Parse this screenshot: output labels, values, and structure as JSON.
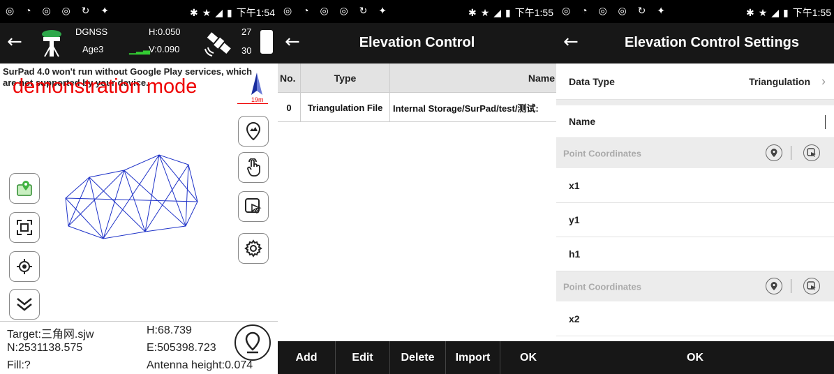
{
  "status_bars": [
    {
      "time": "下午1:54"
    },
    {
      "time": "下午1:55"
    },
    {
      "time": "下午1:55"
    }
  ],
  "survey": {
    "fix_type": "DGNSS",
    "age": "Age3",
    "h_precision": "H:0.050",
    "v_precision": "V:0.090",
    "sats_used": "27",
    "sats_visible": "30",
    "notice": "SurPad 4.0 won't run without Google Play services, which are not supported by your device.",
    "demo_text": "demonstration mode",
    "scale": "19m",
    "target": "Target:三角网.sjw",
    "h_value": "H:68.739",
    "northing": "N:2531138.575",
    "easting": "E:505398.723",
    "fill": "Fill:?",
    "antenna": "Antenna height:0.074"
  },
  "elevation_control": {
    "title": "Elevation Control",
    "columns": [
      "No.",
      "Type",
      "Name"
    ],
    "rows": [
      {
        "no": "0",
        "type": "Triangulation File",
        "name": "Internal Storage/SurPad/test/测试:"
      }
    ],
    "buttons": [
      "Add",
      "Edit",
      "Delete",
      "Import",
      "OK"
    ]
  },
  "settings": {
    "title": "Elevation Control Settings",
    "data_type_label": "Data Type",
    "data_type_value": "Triangulation",
    "name_label": "Name",
    "section_label": "Point Coordinates",
    "fields_a": [
      "x1",
      "y1",
      "h1"
    ],
    "fields_b": [
      "x2"
    ],
    "ok_label": "OK"
  },
  "colors": {
    "bar": "#171717",
    "demo": "#e00000",
    "mesh": "#1f33c8"
  }
}
